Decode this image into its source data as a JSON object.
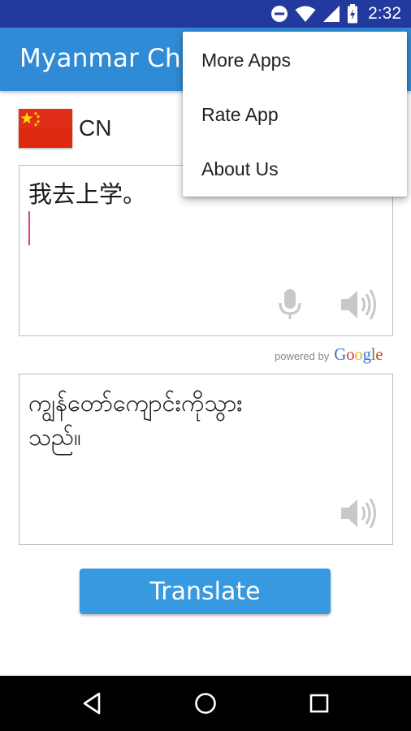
{
  "status_bar": {
    "time": "2:32",
    "icons": [
      "do-not-disturb-icon",
      "wifi-icon",
      "cell-signal-icon",
      "battery-charging-icon"
    ]
  },
  "app_bar": {
    "title": "Myanmar Chinese Translator"
  },
  "source_language": {
    "code": "CN",
    "flag": "china-flag"
  },
  "input": {
    "text": "我去上学。"
  },
  "powered_by": {
    "prefix": "powered by",
    "brand_letters": [
      "G",
      "o",
      "o",
      "g",
      "l",
      "e"
    ]
  },
  "output": {
    "text_line1": "ကျွန်တော်ကျောင်းကိုသွား",
    "text_line2": "သည်။"
  },
  "translate_button": {
    "label": "Translate"
  },
  "menu": {
    "items": [
      {
        "label": "More Apps"
      },
      {
        "label": "Rate App"
      },
      {
        "label": "About Us"
      }
    ]
  },
  "nav": {
    "icons": [
      "back-icon",
      "home-icon",
      "recents-icon"
    ]
  },
  "colors": {
    "status_bar": "#223a9e",
    "app_bar": "#2f8bd5",
    "button": "#3799e0",
    "cursor": "#e0407a"
  }
}
